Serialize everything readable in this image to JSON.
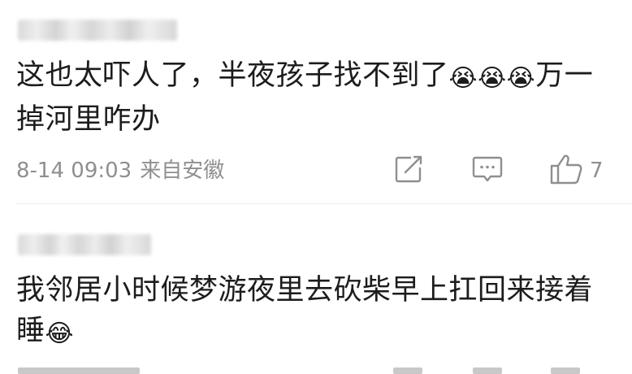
{
  "comments": [
    {
      "text_main": "这也太吓人了，半夜孩子找不到了",
      "emojis": [
        "😭",
        "😭",
        "😭"
      ],
      "text_after": "万一掉河里咋办",
      "date": "8-14 09:03",
      "location": "来自安徽",
      "likes": "7"
    },
    {
      "text_main": "我邻居小时候梦游夜里去砍柴早上扛回来接着睡",
      "emojis": [
        "😂"
      ],
      "text_after": ""
    }
  ],
  "icons": {
    "share": "share-icon",
    "reply": "comment-icon",
    "like": "thumbs-up-icon"
  },
  "colors": {
    "text": "#1c1c1c",
    "meta": "#8f8f8f",
    "divider": "#ededed",
    "background": "#ffffff"
  }
}
